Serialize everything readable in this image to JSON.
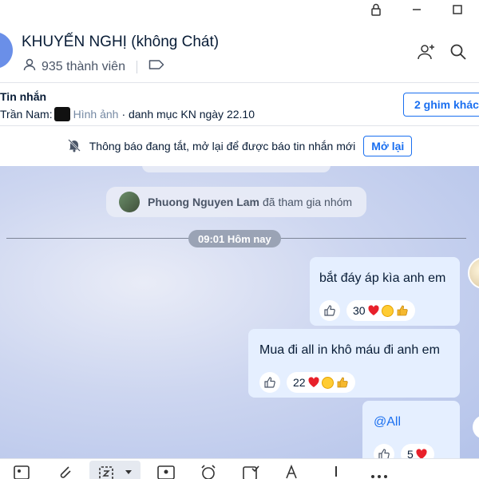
{
  "window": {
    "lock_icon": "lock-icon",
    "restore_icon": "restore-icon",
    "maximize_icon": "maximize-icon"
  },
  "header": {
    "title": "KHUYẾN NGHỊ (không Chát)",
    "member_count": "935 thành viên",
    "icons": [
      "user-icon",
      "tag-icon",
      "add-member-icon",
      "search-icon"
    ]
  },
  "pinned": {
    "label": "Tin nhắn",
    "sender": "Trần Nam:",
    "attachment": "Hình ảnh",
    "text": "· danh mục KN ngày 22.10",
    "pin_button": "2 ghim khác"
  },
  "notification": {
    "text": "Thông báo đang tắt, mở lại để được báo tin nhắn mới",
    "button": "Mở lại"
  },
  "chat": {
    "system_name": "Phuong Nguyen Lam",
    "system_action": "đã tham gia nhóm",
    "time_divider": "09:01 Hôm nay",
    "messages": [
      {
        "text": "bắt đáy áp kìa anh em",
        "count": "30"
      },
      {
        "text": "Mua đi all in khô máu đi anh em",
        "count": "22"
      },
      {
        "text": "@All",
        "count": "5"
      }
    ],
    "colors": {
      "bubble": "#e5efff",
      "accent": "#1a6ff0",
      "heart": "#e8202a"
    }
  },
  "toolbar": {
    "icons": [
      "image-icon",
      "attach-icon",
      "screenshot-icon",
      "contact-card-icon",
      "reminder-icon",
      "task-icon",
      "text-format-icon",
      "urgent-icon",
      "more-icon"
    ]
  }
}
